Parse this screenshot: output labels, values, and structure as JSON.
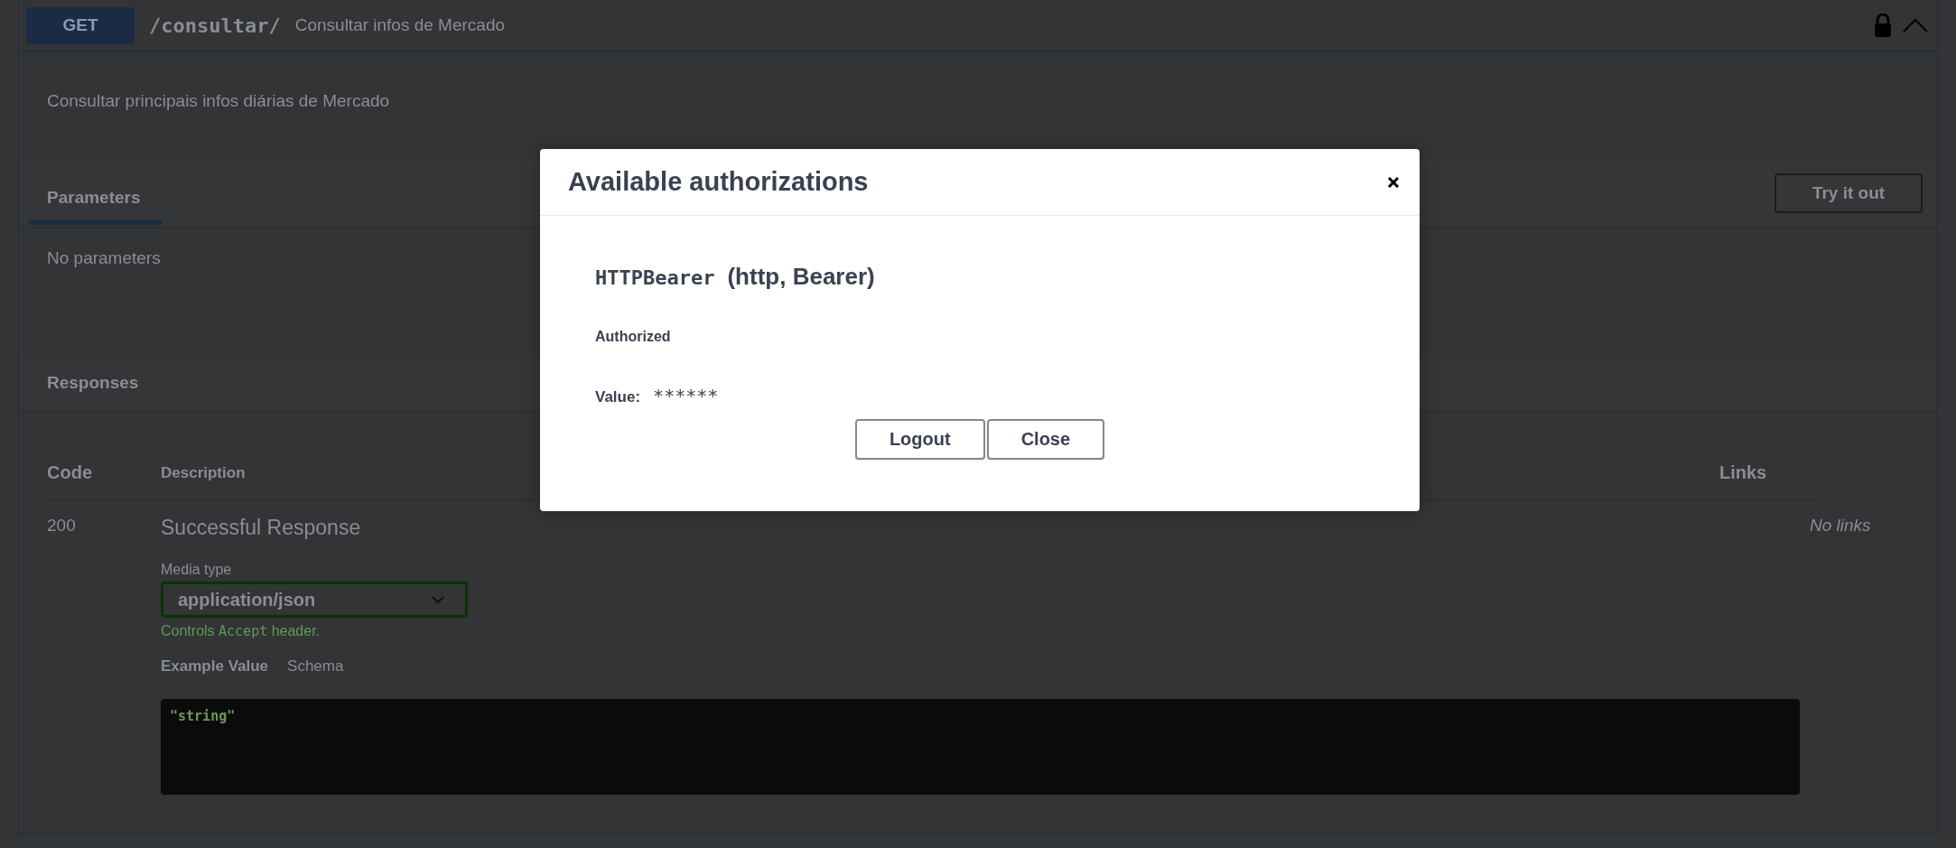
{
  "operation": {
    "method": "GET",
    "path": "/consultar/",
    "summary": "Consultar infos de Mercado",
    "locked": true,
    "expanded": true,
    "description": "Consultar principais infos diárias de Mercado"
  },
  "parameters": {
    "tab": "Parameters",
    "try_button": "Try it out",
    "empty_text": "No parameters"
  },
  "responses": {
    "title": "Responses",
    "columns": [
      "Code",
      "Description",
      "Links"
    ],
    "rows": [
      {
        "code": "200",
        "description": "Successful Response",
        "media_type_label": "Media type",
        "media_type": "application/json",
        "controls_note": [
          "Controls ",
          "Accept",
          " header."
        ],
        "example_tabs": [
          {
            "label": "Example Value",
            "selected": true
          },
          {
            "label": "Schema",
            "selected": false
          }
        ],
        "example": "\"string\"",
        "links": "No links"
      }
    ]
  },
  "modal": {
    "title": "Available authorizations",
    "scheme_name": "HTTPBearer",
    "scheme_type": "(http, Bearer)",
    "status": "Authorized",
    "value_label": "Value:",
    "value": "******",
    "buttons": [
      "Logout",
      "Close"
    ]
  }
}
